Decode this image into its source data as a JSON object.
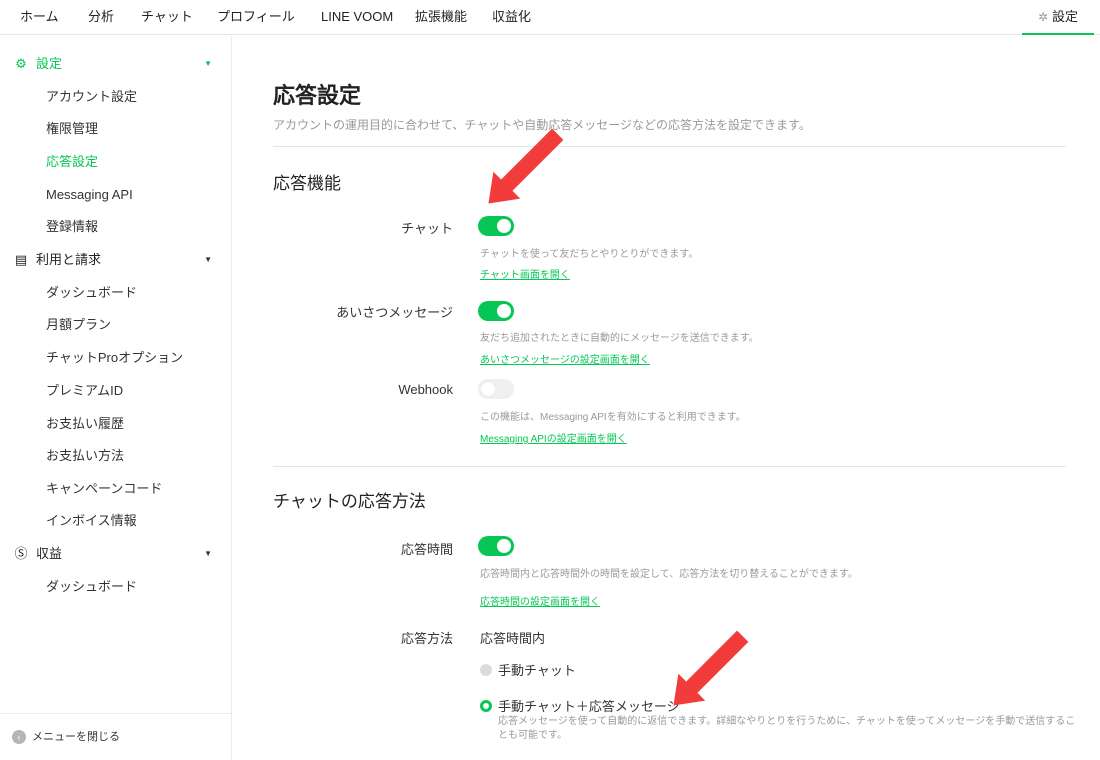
{
  "topnav": {
    "tabs": [
      "ホーム",
      "分析",
      "チャット",
      "プロフィール",
      "LINE VOOM",
      "拡張機能",
      "収益化"
    ],
    "settings_label": "設定",
    "settings_icon": "gear-icon"
  },
  "sidebar": {
    "sections": [
      {
        "label": "設定",
        "icon": "gear-icon",
        "items": [
          "アカウント設定",
          "権限管理",
          "応答設定",
          "Messaging API",
          "登録情報"
        ]
      },
      {
        "label": "利用と請求",
        "icon": "receipt-icon",
        "items": [
          "ダッシュボード",
          "月額プラン",
          "チャットProオプション",
          "プレミアムID",
          "お支払い履歴",
          "お支払い方法",
          "キャンペーンコード",
          "インボイス情報"
        ]
      },
      {
        "label": "収益",
        "icon": "coin-icon",
        "items": [
          "ダッシュボード"
        ]
      }
    ],
    "active_item": "応答設定",
    "collapse_label": "メニューを閉じる"
  },
  "main": {
    "title": "応答設定",
    "subtitle": "アカウントの運用目的に合わせて、チャットや自動応答メッセージなどの応答方法を設定できます。",
    "section1_title": "応答機能",
    "features": [
      {
        "label": "チャット",
        "enabled": true,
        "desc": "チャットを使って友だちとやりとりができます。",
        "link": "チャット画面を開く"
      },
      {
        "label": "あいさつメッセージ",
        "enabled": true,
        "desc": "友だち追加されたときに自動的にメッセージを送信できます。",
        "link": "あいさつメッセージの設定画面を開く"
      },
      {
        "label": "Webhook",
        "enabled": false,
        "desc": "この機能は、Messaging APIを有効にすると利用できます。",
        "link": "Messaging APIの設定画面を開く"
      }
    ],
    "section2_title": "チャットの応答方法",
    "response_time": {
      "label": "応答時間",
      "enabled": true,
      "desc": "応答時間内と応答時間外の時間を設定して、応答方法を切り替えることができます。",
      "link": "応答時間の設定画面を開く"
    },
    "response_method": {
      "label": "応答方法",
      "heading": "応答時間内",
      "options": [
        {
          "label": "手動チャット",
          "checked": false
        },
        {
          "label": "手動チャット＋応答メッセージ",
          "checked": true,
          "desc": "応答メッセージを使って自動的に返信できます。詳細なやりとりを行うために、チャットを使ってメッセージを手動で送信することも可能です。"
        }
      ]
    }
  },
  "colors": {
    "accent": "#06c755",
    "arrow": "#f23c3c"
  }
}
